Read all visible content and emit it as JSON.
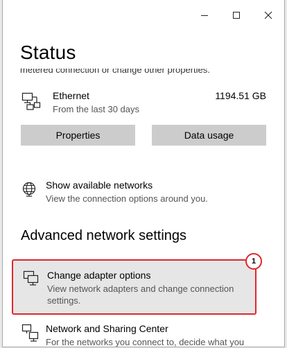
{
  "window": {
    "title": "Status",
    "controls": {
      "minimize": "minimize-icon",
      "maximize": "maximize-icon",
      "close": "close-icon"
    }
  },
  "partial_text": "metered connection or change other properties.",
  "ethernet": {
    "name": "Ethernet",
    "subtitle": "From the last 30 days",
    "usage": "1194.51 GB",
    "icon": "ethernet-pc-icon"
  },
  "buttons": {
    "properties": "Properties",
    "data_usage": "Data usage"
  },
  "show_networks": {
    "title": "Show available networks",
    "subtitle": "View the connection options around you.",
    "icon": "globe-icon"
  },
  "advanced": {
    "heading": "Advanced network settings"
  },
  "adapter": {
    "title": "Change adapter options",
    "subtitle_line1": "View network adapters and change connection",
    "subtitle_line2": "settings.",
    "icon": "network-adapter-icon",
    "annotation": "1"
  },
  "sharing": {
    "title": "Network and Sharing Center",
    "subtitle": "For the networks you connect to, decide what you",
    "icon": "network-sharing-icon"
  },
  "colors": {
    "highlight_border": "#e0262c",
    "button_bg": "#cccccc",
    "highlight_bg": "#e6e6e6"
  }
}
